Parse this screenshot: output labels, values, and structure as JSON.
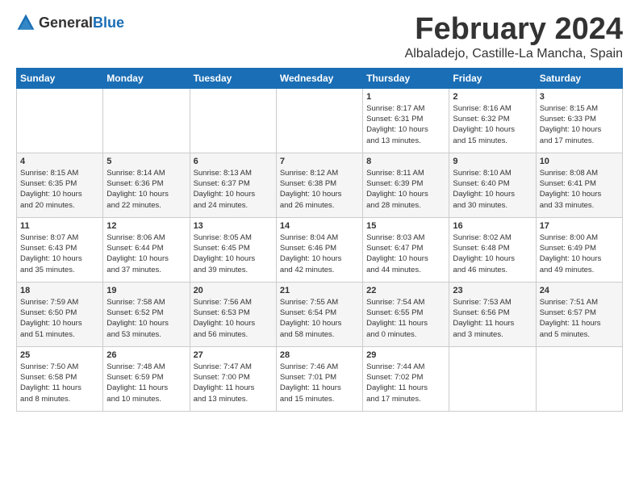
{
  "header": {
    "logo_general": "General",
    "logo_blue": "Blue",
    "month": "February 2024",
    "location": "Albaladejo, Castille-La Mancha, Spain"
  },
  "days_of_week": [
    "Sunday",
    "Monday",
    "Tuesday",
    "Wednesday",
    "Thursday",
    "Friday",
    "Saturday"
  ],
  "weeks": [
    [
      {
        "day": "",
        "info": ""
      },
      {
        "day": "",
        "info": ""
      },
      {
        "day": "",
        "info": ""
      },
      {
        "day": "",
        "info": ""
      },
      {
        "day": "1",
        "info": "Sunrise: 8:17 AM\nSunset: 6:31 PM\nDaylight: 10 hours\nand 13 minutes."
      },
      {
        "day": "2",
        "info": "Sunrise: 8:16 AM\nSunset: 6:32 PM\nDaylight: 10 hours\nand 15 minutes."
      },
      {
        "day": "3",
        "info": "Sunrise: 8:15 AM\nSunset: 6:33 PM\nDaylight: 10 hours\nand 17 minutes."
      }
    ],
    [
      {
        "day": "4",
        "info": "Sunrise: 8:15 AM\nSunset: 6:35 PM\nDaylight: 10 hours\nand 20 minutes."
      },
      {
        "day": "5",
        "info": "Sunrise: 8:14 AM\nSunset: 6:36 PM\nDaylight: 10 hours\nand 22 minutes."
      },
      {
        "day": "6",
        "info": "Sunrise: 8:13 AM\nSunset: 6:37 PM\nDaylight: 10 hours\nand 24 minutes."
      },
      {
        "day": "7",
        "info": "Sunrise: 8:12 AM\nSunset: 6:38 PM\nDaylight: 10 hours\nand 26 minutes."
      },
      {
        "day": "8",
        "info": "Sunrise: 8:11 AM\nSunset: 6:39 PM\nDaylight: 10 hours\nand 28 minutes."
      },
      {
        "day": "9",
        "info": "Sunrise: 8:10 AM\nSunset: 6:40 PM\nDaylight: 10 hours\nand 30 minutes."
      },
      {
        "day": "10",
        "info": "Sunrise: 8:08 AM\nSunset: 6:41 PM\nDaylight: 10 hours\nand 33 minutes."
      }
    ],
    [
      {
        "day": "11",
        "info": "Sunrise: 8:07 AM\nSunset: 6:43 PM\nDaylight: 10 hours\nand 35 minutes."
      },
      {
        "day": "12",
        "info": "Sunrise: 8:06 AM\nSunset: 6:44 PM\nDaylight: 10 hours\nand 37 minutes."
      },
      {
        "day": "13",
        "info": "Sunrise: 8:05 AM\nSunset: 6:45 PM\nDaylight: 10 hours\nand 39 minutes."
      },
      {
        "day": "14",
        "info": "Sunrise: 8:04 AM\nSunset: 6:46 PM\nDaylight: 10 hours\nand 42 minutes."
      },
      {
        "day": "15",
        "info": "Sunrise: 8:03 AM\nSunset: 6:47 PM\nDaylight: 10 hours\nand 44 minutes."
      },
      {
        "day": "16",
        "info": "Sunrise: 8:02 AM\nSunset: 6:48 PM\nDaylight: 10 hours\nand 46 minutes."
      },
      {
        "day": "17",
        "info": "Sunrise: 8:00 AM\nSunset: 6:49 PM\nDaylight: 10 hours\nand 49 minutes."
      }
    ],
    [
      {
        "day": "18",
        "info": "Sunrise: 7:59 AM\nSunset: 6:50 PM\nDaylight: 10 hours\nand 51 minutes."
      },
      {
        "day": "19",
        "info": "Sunrise: 7:58 AM\nSunset: 6:52 PM\nDaylight: 10 hours\nand 53 minutes."
      },
      {
        "day": "20",
        "info": "Sunrise: 7:56 AM\nSunset: 6:53 PM\nDaylight: 10 hours\nand 56 minutes."
      },
      {
        "day": "21",
        "info": "Sunrise: 7:55 AM\nSunset: 6:54 PM\nDaylight: 10 hours\nand 58 minutes."
      },
      {
        "day": "22",
        "info": "Sunrise: 7:54 AM\nSunset: 6:55 PM\nDaylight: 11 hours\nand 0 minutes."
      },
      {
        "day": "23",
        "info": "Sunrise: 7:53 AM\nSunset: 6:56 PM\nDaylight: 11 hours\nand 3 minutes."
      },
      {
        "day": "24",
        "info": "Sunrise: 7:51 AM\nSunset: 6:57 PM\nDaylight: 11 hours\nand 5 minutes."
      }
    ],
    [
      {
        "day": "25",
        "info": "Sunrise: 7:50 AM\nSunset: 6:58 PM\nDaylight: 11 hours\nand 8 minutes."
      },
      {
        "day": "26",
        "info": "Sunrise: 7:48 AM\nSunset: 6:59 PM\nDaylight: 11 hours\nand 10 minutes."
      },
      {
        "day": "27",
        "info": "Sunrise: 7:47 AM\nSunset: 7:00 PM\nDaylight: 11 hours\nand 13 minutes."
      },
      {
        "day": "28",
        "info": "Sunrise: 7:46 AM\nSunset: 7:01 PM\nDaylight: 11 hours\nand 15 minutes."
      },
      {
        "day": "29",
        "info": "Sunrise: 7:44 AM\nSunset: 7:02 PM\nDaylight: 11 hours\nand 17 minutes."
      },
      {
        "day": "",
        "info": ""
      },
      {
        "day": "",
        "info": ""
      }
    ]
  ]
}
